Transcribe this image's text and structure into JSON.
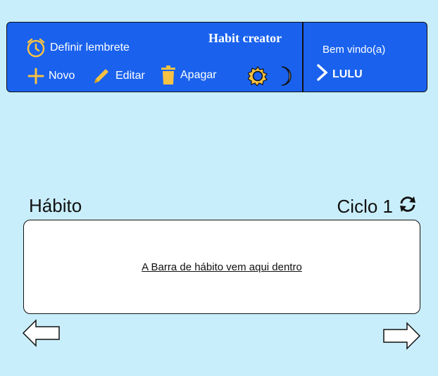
{
  "toolbar": {
    "app_title": "Habit creator",
    "reminder_label": "Definir lembrete",
    "new_label": "Novo",
    "edit_label": "Editar",
    "delete_label": "Apagar"
  },
  "user_panel": {
    "welcome": "Bem vindo(a)",
    "username": "LULU"
  },
  "main": {
    "section_title": "Hábito",
    "cycle_label": "Ciclo 1",
    "habit_placeholder": "A Barra de hábito vem aqui dentro"
  },
  "colors": {
    "toolbar_bg": "#1a62ee",
    "page_bg": "#c9eefb",
    "icon_yellow": "#f6c244"
  },
  "icons": [
    "alarm-clock-icon",
    "plus-icon",
    "pencil-icon",
    "trash-icon",
    "sun-icon",
    "moon-icon",
    "chevron-right-icon",
    "refresh-icon",
    "arrow-left-icon",
    "arrow-right-icon"
  ]
}
